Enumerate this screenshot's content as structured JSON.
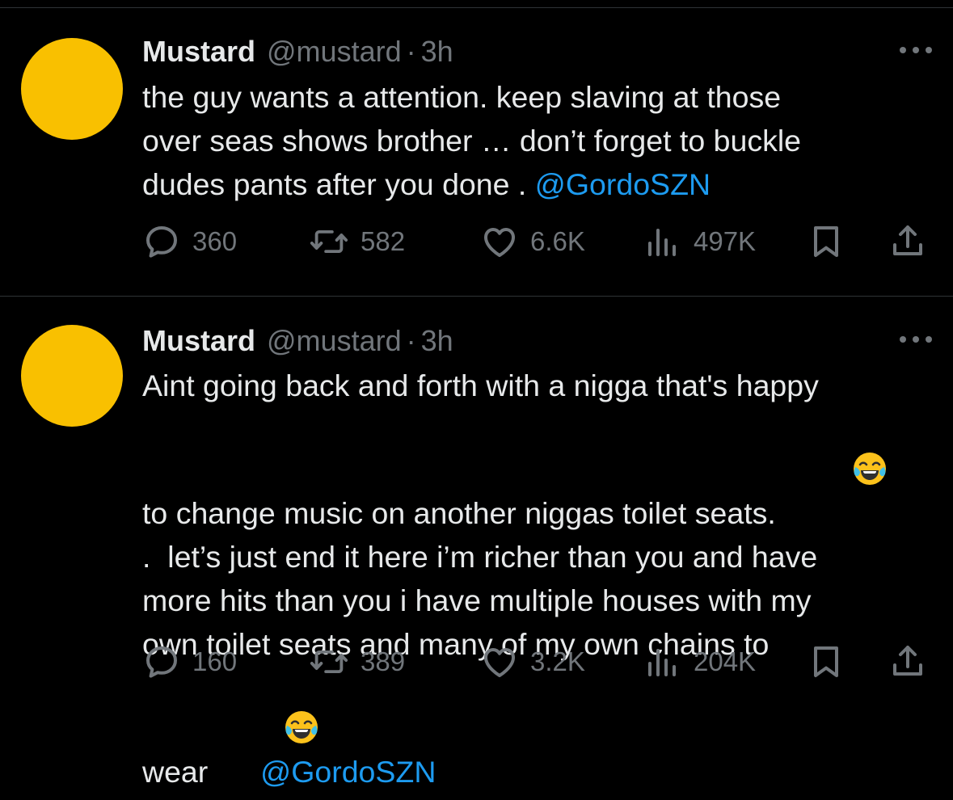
{
  "colors": {
    "background": "#000000",
    "text": "#e7e9ea",
    "muted": "#71767b",
    "link": "#1d9bf0",
    "avatar": "#f9c000",
    "divider": "#2f3336"
  },
  "tweets": [
    {
      "author": {
        "name": "Mustard",
        "handle": "@mustard",
        "avatar_icon": "avatar-circle"
      },
      "separator": "·",
      "time": "3h",
      "lines": [
        [
          {
            "text": "the guy wants a attention. keep slaving at those"
          }
        ],
        [
          {
            "text": "over seas shows brother … don’t forget to buckle"
          }
        ],
        [
          {
            "text": "dudes pants after you done . "
          },
          {
            "mention": "@GordoSZN"
          }
        ]
      ],
      "stats": {
        "replies": "360",
        "reposts": "582",
        "likes": "6.6K",
        "views": "497K"
      }
    },
    {
      "author": {
        "name": "Mustard",
        "handle": "@mustard",
        "avatar_icon": "avatar-circle"
      },
      "separator": "·",
      "time": "3h",
      "lines": [
        [
          {
            "text": "Aint going back and forth with a nigga that's happy"
          }
        ],
        [
          {
            "text": "to change music on another niggas toilet seats. "
          },
          {
            "emoji": "😂"
          }
        ],
        [
          {
            "text": ".  let’s just end it here i’m richer than you and have"
          }
        ],
        [
          {
            "text": "more hits than you i have multiple houses with my"
          }
        ],
        [
          {
            "text": "own toilet seats and many of my own chains to"
          }
        ],
        [
          {
            "text": "wear "
          },
          {
            "emoji": "😂"
          },
          {
            "text": " "
          },
          {
            "mention": "@GordoSZN"
          }
        ]
      ],
      "stats": {
        "replies": "160",
        "reposts": "389",
        "likes": "3.2K",
        "views": "204K"
      }
    }
  ],
  "icons": [
    "reply-icon",
    "repost-icon",
    "like-icon",
    "views-icon",
    "bookmark-icon",
    "share-icon",
    "more-icon",
    "laughing-emoji"
  ]
}
